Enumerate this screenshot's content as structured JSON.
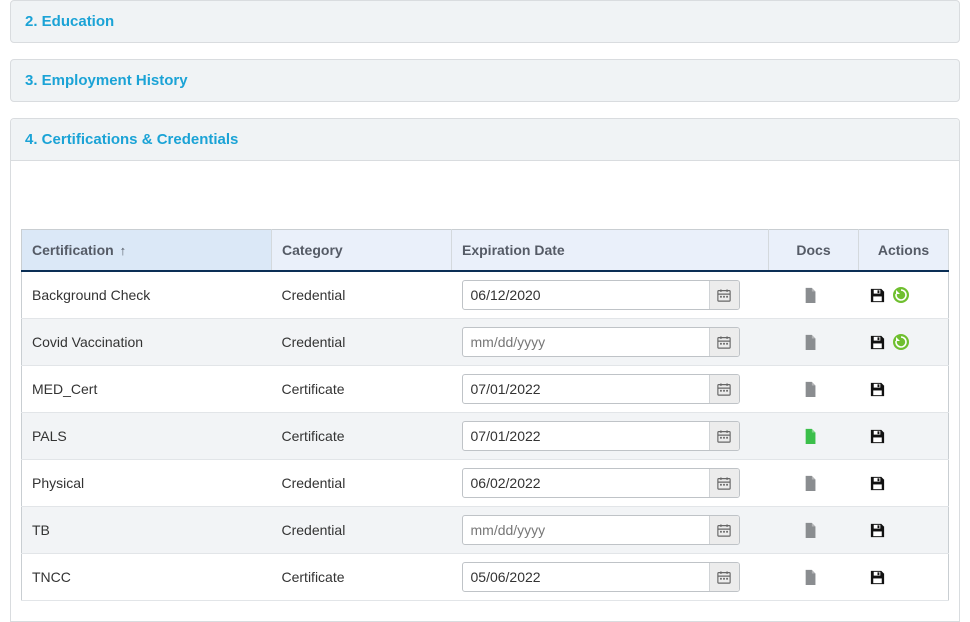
{
  "sections": {
    "education": "2. Education",
    "employment": "3. Employment History",
    "certs": "4. Certifications & Credentials"
  },
  "table": {
    "headers": {
      "certification": "Certification",
      "category": "Category",
      "expiration": "Expiration Date",
      "docs": "Docs",
      "actions": "Actions"
    },
    "sort_indicator": "↑",
    "date_placeholder": "mm/dd/yyyy",
    "rows": [
      {
        "name": "Background Check",
        "category": "Credential",
        "date": "06/12/2020",
        "doc_color": "gray",
        "extra_action": true
      },
      {
        "name": "Covid Vaccination",
        "category": "Credential",
        "date": "",
        "doc_color": "gray",
        "extra_action": true
      },
      {
        "name": "MED_Cert",
        "category": "Certificate",
        "date": "07/01/2022",
        "doc_color": "gray",
        "extra_action": false
      },
      {
        "name": "PALS",
        "category": "Certificate",
        "date": "07/01/2022",
        "doc_color": "green",
        "extra_action": false
      },
      {
        "name": "Physical",
        "category": "Credential",
        "date": "06/02/2022",
        "doc_color": "gray",
        "extra_action": false
      },
      {
        "name": "TB",
        "category": "Credential",
        "date": "",
        "doc_color": "gray",
        "extra_action": false
      },
      {
        "name": "TNCC",
        "category": "Certificate",
        "date": "05/06/2022",
        "doc_color": "gray",
        "extra_action": false
      }
    ]
  },
  "colors": {
    "doc_gray": "#8a8d90",
    "doc_green": "#3bbf4a",
    "save_black": "#111",
    "refresh_green": "#6fbf2f"
  }
}
